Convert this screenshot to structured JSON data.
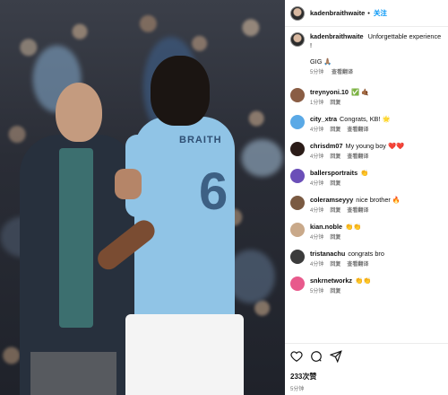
{
  "post": {
    "author": "kadenbraithwaite",
    "follow_dot": "•",
    "follow_label": "关注",
    "jersey_name": "BRAITH",
    "jersey_number": "6"
  },
  "caption": {
    "user": "kadenbraithwaite",
    "text": "Unforgettable experience !",
    "line2": "GIG 🙏🏽",
    "time": "5分钟",
    "translate": "查看翻译"
  },
  "comments": [
    {
      "user": "treynyoni.10",
      "text": "✅ 🤙🏾",
      "time": "1分钟",
      "reply": "回复",
      "translate": "",
      "avatar_color": "#8a5d44"
    },
    {
      "user": "city_xtra",
      "text": "Congrats, KB! 🌟",
      "time": "4分钟",
      "reply": "回复",
      "translate": "查看翻译",
      "avatar_color": "#5aa9e6"
    },
    {
      "user": "chrisdm07",
      "text": "My young boy ❤️❤️",
      "time": "4分钟",
      "reply": "回复",
      "translate": "查看翻译",
      "avatar_color": "#2b1c18"
    },
    {
      "user": "ballersportraits",
      "text": "👏",
      "time": "4分钟",
      "reply": "回复",
      "translate": "",
      "avatar_color": "#6b4fb8"
    },
    {
      "user": "coleramseyyy",
      "text": "nice brother 🔥",
      "time": "4分钟",
      "reply": "回复",
      "translate": "查看翻译",
      "avatar_color": "#7a5a42"
    },
    {
      "user": "kian.noble",
      "text": "👏👏",
      "time": "4分钟",
      "reply": "回复",
      "translate": "",
      "avatar_color": "#c9a98a"
    },
    {
      "user": "tristanachu",
      "text": "congrats bro",
      "time": "4分钟",
      "reply": "回复",
      "translate": "查看翻译",
      "avatar_color": "#3b3b3b"
    },
    {
      "user": "snkrnetworkz",
      "text": "👏👏",
      "time": "5分钟",
      "reply": "回复",
      "translate": "",
      "avatar_color": "#e85a8c"
    }
  ],
  "footer": {
    "likes": "233次赞",
    "date": "5分钟"
  },
  "colors": {
    "link_blue": "#0095f6",
    "meta_gray": "#737373",
    "jersey_blue": "#90c4e6"
  },
  "icons": [
    "heart-icon",
    "comment-icon",
    "share-icon"
  ]
}
